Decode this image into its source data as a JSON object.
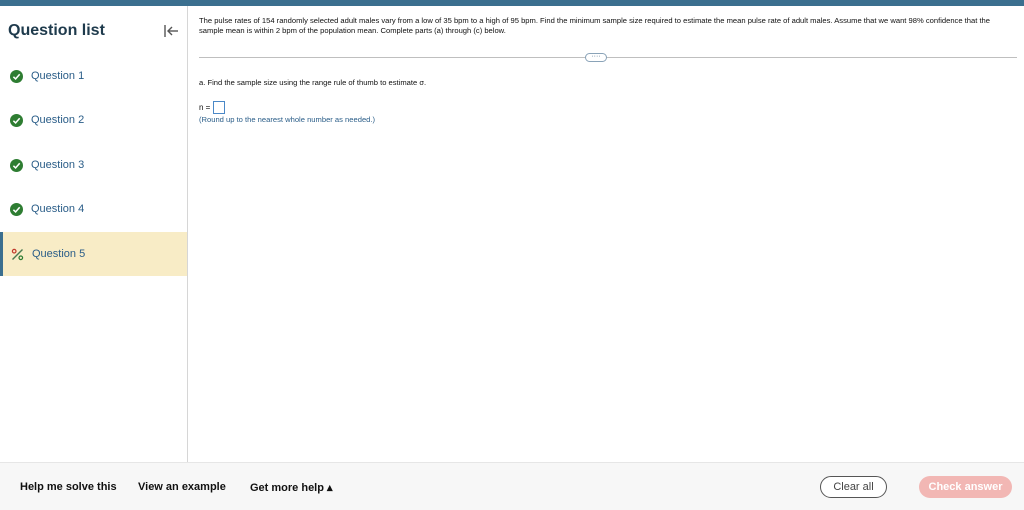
{
  "sidebar": {
    "title": "Question list",
    "items": [
      {
        "label": "Question 1",
        "status": "complete"
      },
      {
        "label": "Question 2",
        "status": "complete"
      },
      {
        "label": "Question 3",
        "status": "complete"
      },
      {
        "label": "Question 4",
        "status": "complete"
      },
      {
        "label": "Question 5",
        "status": "partial"
      }
    ]
  },
  "question": {
    "text": "The pulse rates of 154 randomly selected adult males vary from a low of 35 bpm to a high of 95 bpm. Find the minimum sample size required to estimate the mean pulse rate of adult males. Assume that we want 98% confidence that the sample mean is within 2 bpm of the population mean. Complete parts (a) through (c) below.",
    "more_label": "····",
    "part_a": "a. Find the sample size using the range rule of thumb to estimate σ.",
    "answer_label": "n =",
    "answer_value": "",
    "hint": "(Round up to the nearest whole number as needed.)"
  },
  "footer": {
    "help_solve": "Help me solve this",
    "view_example": "View an example",
    "get_more_help": "Get more help ▴",
    "clear_all": "Clear all",
    "check_answer": "Check answer"
  },
  "colors": {
    "topbar": "#3b6f8f",
    "complete": "#2e7d32",
    "partial_active_bg": "#f8ecc6",
    "link_blue": "#2a5d88",
    "check_button": "#f2b7b4"
  }
}
